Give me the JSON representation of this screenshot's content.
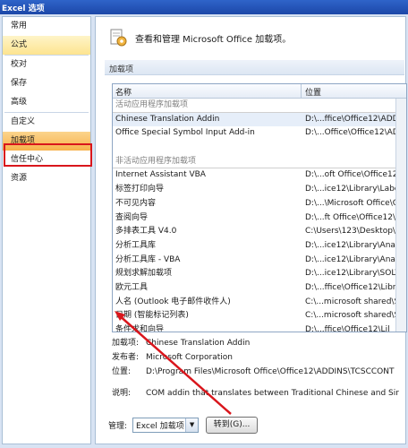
{
  "window": {
    "title": "Excel 选项"
  },
  "sidebar": {
    "items": [
      {
        "label": "常用"
      },
      {
        "label": "公式"
      },
      {
        "label": "校对"
      },
      {
        "label": "保存"
      },
      {
        "label": "高级"
      },
      {
        "label": "自定义"
      },
      {
        "label": "加载项"
      },
      {
        "label": "信任中心"
      },
      {
        "label": "资源"
      }
    ]
  },
  "header": {
    "text": "查看和管理 Microsoft Office 加载项。"
  },
  "section": {
    "title": "加载项"
  },
  "list": {
    "columns": {
      "name": "名称",
      "location": "位置"
    },
    "active_group": "活动应用程序加载项",
    "active_rows": [
      {
        "name": "Chinese Translation Addin",
        "location": "D:\\...ffice\\Office12\\ADDINS"
      },
      {
        "name": "Office Special Symbol Input Add-in",
        "location": "D:\\...Office\\Office12\\ADDI"
      }
    ],
    "inactive_group": "非活动应用程序加载项",
    "inactive_rows": [
      {
        "name": "Internet Assistant VBA",
        "location": "D:\\...oft Office\\Office12\\Lil"
      },
      {
        "name": "标签打印向导",
        "location": "D:\\...ice12\\Library\\Label P"
      },
      {
        "name": "不可见内容",
        "location": "D:\\...\\Microsoft Office\\Offic"
      },
      {
        "name": "查阅向导",
        "location": "D:\\...ft Office\\Office12\\Lil"
      },
      {
        "name": "多排表工具 V4.0",
        "location": "C:\\Users\\123\\Desktop\\Dp"
      },
      {
        "name": "分析工具库",
        "location": "D:\\...ice12\\Library\\Anal"
      },
      {
        "name": "分析工具库 - VBA",
        "location": "D:\\...ice12\\Library\\Analysis"
      },
      {
        "name": "规划求解加载项",
        "location": "D:\\...ice12\\Library\\SOLV"
      },
      {
        "name": "欧元工具",
        "location": "D:\\...ffice\\Office12\\Library"
      },
      {
        "name": "人名 (Outlook 电子邮件收件人)",
        "location": "C:\\...microsoft shared\\Sm"
      },
      {
        "name": "日期 (智能标记列表)",
        "location": "C:\\...microsoft shared\\Sma"
      },
      {
        "name": "条件求和向导",
        "location": "D:\\...ffice\\Office12\\Lil"
      }
    ]
  },
  "details": {
    "addin_label": "加载项:",
    "addin_value": "Chinese Translation Addin",
    "publisher_label": "发布者:",
    "publisher_value": "Microsoft Corporation",
    "location_label": "位置:",
    "location_value": "D:\\Program Files\\Microsoft Office\\Office12\\ADDINS\\TCSCCONT",
    "desc_label": "说明:",
    "desc_value": "COM addin that translates between Traditional Chinese and Sir"
  },
  "bottom": {
    "manage_label": "管理:",
    "manage_select": "Excel 加载项",
    "go_button": "转到(G)..."
  },
  "colors": {
    "highlight_box": "#d9161c",
    "title_bar": "#1c47a8",
    "selected_tab": "#f8b24b"
  }
}
